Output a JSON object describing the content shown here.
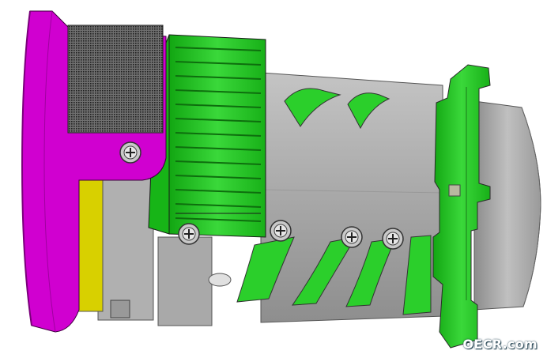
{
  "watermark": {
    "text": "OECR.com"
  },
  "colors": {
    "background": "#ffffff",
    "flange": "#d000d0",
    "focus_ring": "#22c422",
    "barrel": "#a9a9a9",
    "spacer": "#d8d000",
    "knurl": "#404040"
  },
  "icons": [
    "screw-icon"
  ]
}
